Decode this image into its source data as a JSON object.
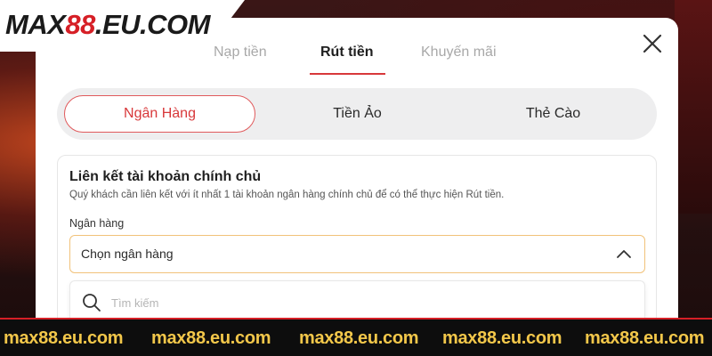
{
  "logo": {
    "part1": "MAX",
    "part2": "88",
    "part3": ".EU.COM"
  },
  "tabs": [
    {
      "label": "Nạp tiền",
      "active": false
    },
    {
      "label": "Rút tiền",
      "active": true
    },
    {
      "label": "Khuyến mãi",
      "active": false
    }
  ],
  "segments": [
    {
      "label": "Ngân Hàng",
      "active": true
    },
    {
      "label": "Tiền Ảo",
      "active": false
    },
    {
      "label": "Thẻ Cào",
      "active": false
    }
  ],
  "card": {
    "title": "Liên kết tài khoản chính chủ",
    "description": "Quý khách cần liên kết với ít nhất 1 tài khoản ngân hàng chính chủ để có thể thực hiện Rút tiền.",
    "bank_label": "Ngân hàng",
    "bank_select_value": "Chọn ngân hàng",
    "search_placeholder": "Tìm kiếm"
  },
  "watermark": [
    "max88.eu.com",
    "max88.eu.com",
    "max88.eu.com",
    "max88.eu.com",
    "max88.eu.com"
  ],
  "colors": {
    "accent": "#d8383a",
    "select_border": "#f1c27a",
    "watermark": "#f2c74a"
  },
  "icons": {
    "close": "close-icon",
    "chevron": "chevron-up-icon",
    "search": "search-icon"
  }
}
